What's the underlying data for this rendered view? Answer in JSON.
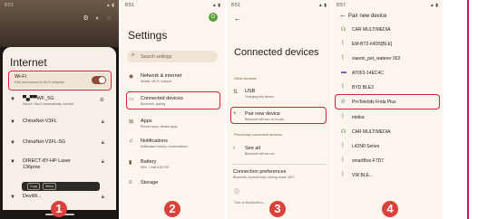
{
  "panel1": {
    "status": "8:51",
    "title": "Internet",
    "wifi": {
      "label": "Wi-Fi",
      "sub": "Find and connect to Wi-Fi networks",
      "on": true
    },
    "networks": [
      {
        "name": "▀▄▀▀WF_5G",
        "sub": "Saved / Won't automatically connect"
      },
      {
        "name": "ChinaNet-V3FL",
        "sub": ""
      },
      {
        "name": "ChinaNet-V3FL-5G",
        "sub": ""
      },
      {
        "name": "DIRECT-8Y-HP Laser 136pnw",
        "sub": ""
      },
      {
        "name": "DevWi...",
        "sub": ""
      }
    ],
    "toast_chips": [
      "Copy",
      "Mirror"
    ],
    "badge": "1"
  },
  "panel2": {
    "status": "8:51",
    "title": "Settings",
    "avatar": "G",
    "search_placeholder": "Search settings",
    "items": [
      {
        "icon": "wifi-icon",
        "glyph": "◉",
        "title": "Network & internet",
        "sub": "Mobile, Wi-Fi, hotspot"
      },
      {
        "icon": "devices-icon",
        "glyph": "▭",
        "title": "Connected devices",
        "sub": "Bluetooth, pairing"
      },
      {
        "icon": "apps-icon",
        "glyph": "⊞",
        "title": "Apps",
        "sub": "Recent apps, default apps"
      },
      {
        "icon": "bell-icon",
        "glyph": "♫",
        "title": "Notifications",
        "sub": "Notification history, conversations"
      },
      {
        "icon": "battery-icon",
        "glyph": "▮",
        "title": "Battery",
        "sub": "95% - Until 6:00 PM"
      },
      {
        "icon": "storage-icon",
        "glyph": "≡",
        "title": "Storage",
        "sub": ""
      }
    ],
    "badge": "2"
  },
  "panel3": {
    "status": "8:51",
    "title": "Connected devices",
    "other_devices": "Other devices",
    "usb": {
      "title": "USB",
      "sub": "Charging this device"
    },
    "pair": {
      "title": "Pair new device",
      "sub": "Bluetooth will turn on to pair"
    },
    "previously": "Previously connected devices",
    "see_all": {
      "title": "See all",
      "sub": "Bluetooth will turn on"
    },
    "prefs": {
      "title": "Connection preferences",
      "sub": "Bluetooth, Android Auto, driving mode, NFC"
    },
    "footer": "Turn on Bluetooth to...",
    "badge": "3"
  },
  "panel4": {
    "status": "8:57",
    "title": "Pair new device",
    "devices": [
      {
        "name": "CAR MULTIMEDIA",
        "icon": "headset-icon",
        "glyph": "☊",
        "color": "#6b8e4e"
      },
      {
        "name": "EM-BT2-64D5[BLE]",
        "icon": "bluetooth-icon",
        "glyph": "ᛒ",
        "color": "#8a6a3a"
      },
      {
        "name": "xiaomi_pet_waterer 002",
        "icon": "bluetooth-icon",
        "glyph": "ᛒ",
        "color": "#8a6a3a"
      },
      {
        "name": "AT001-14EC4C",
        "icon": "laptop-icon",
        "glyph": "▬",
        "color": "#6a5a9a"
      },
      {
        "name": "BYD BLE3",
        "icon": "bluetooth-icon",
        "glyph": "ᛒ",
        "color": "#8a6a3a"
      },
      {
        "name": "ProTelebits Frida Plus",
        "icon": "phone-icon",
        "glyph": "✆",
        "color": "#3a7a7a"
      },
      {
        "name": "midea",
        "icon": "bluetooth-icon",
        "glyph": "ᛒ",
        "color": "#8a6a3a"
      },
      {
        "name": "CAR MULTIMEDIA",
        "icon": "headset-icon",
        "glyph": "☊",
        "color": "#6b8e4e"
      },
      {
        "name": "L42N0 Series",
        "icon": "bluetooth-icon",
        "glyph": "ᛒ",
        "color": "#8a6a3a"
      },
      {
        "name": "smartBox-F7D7",
        "icon": "bluetooth-icon",
        "glyph": "ᛒ",
        "color": "#8a6a3a"
      },
      {
        "name": "VW BLE...",
        "icon": "bluetooth-icon",
        "glyph": "ᛒ",
        "color": "#8a6a3a"
      }
    ],
    "badge": "4"
  },
  "colors": {
    "highlight": "#d8203a",
    "badge": "#d9413a",
    "accent": "#c4175a",
    "toggle": "#8b4b3a"
  }
}
